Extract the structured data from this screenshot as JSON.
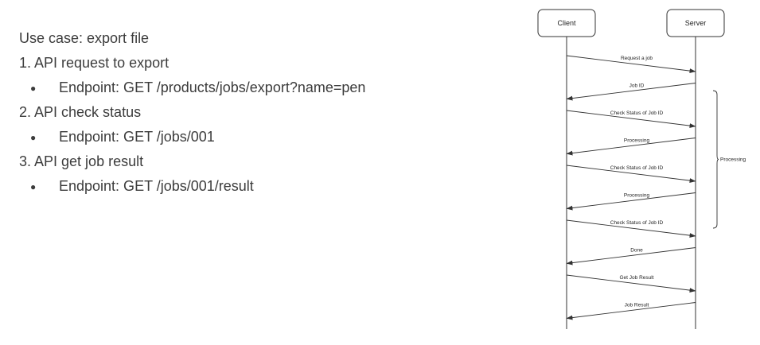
{
  "notes": {
    "lines": [
      {
        "text": "Use case: export file",
        "level": 0
      },
      {
        "text": "1. API request to export",
        "level": 0
      },
      {
        "text": "Endpoint: GET /products/jobs/export?name=pen",
        "level": 1
      },
      {
        "text": "2. API check status",
        "level": 0
      },
      {
        "text": "Endpoint: GET /jobs/001",
        "level": 1
      },
      {
        "text": "3. API get job result",
        "level": 0
      },
      {
        "text": "Endpoint: GET /jobs/001/result",
        "level": 1
      }
    ],
    "bullet_glyph": "●"
  },
  "sequence": {
    "actors": [
      {
        "id": "client",
        "label": "Client"
      },
      {
        "id": "server",
        "label": "Server"
      }
    ],
    "messages": [
      {
        "label": "Request a job",
        "from": "client",
        "to": "server"
      },
      {
        "label": "Job ID",
        "from": "server",
        "to": "client"
      },
      {
        "label": "Check Status of Job ID",
        "from": "client",
        "to": "server"
      },
      {
        "label": "Processing",
        "from": "server",
        "to": "client"
      },
      {
        "label": "Check Status of Job ID",
        "from": "client",
        "to": "server"
      },
      {
        "label": "Processing",
        "from": "server",
        "to": "client"
      },
      {
        "label": "Check Status of Job ID",
        "from": "client",
        "to": "server"
      },
      {
        "label": "Done",
        "from": "server",
        "to": "client"
      },
      {
        "label": "Get Job Result",
        "from": "client",
        "to": "server"
      },
      {
        "label": "Job Result",
        "from": "server",
        "to": "client"
      }
    ],
    "group": {
      "label": "Processing",
      "first_message": 2,
      "last_message": 6
    }
  }
}
